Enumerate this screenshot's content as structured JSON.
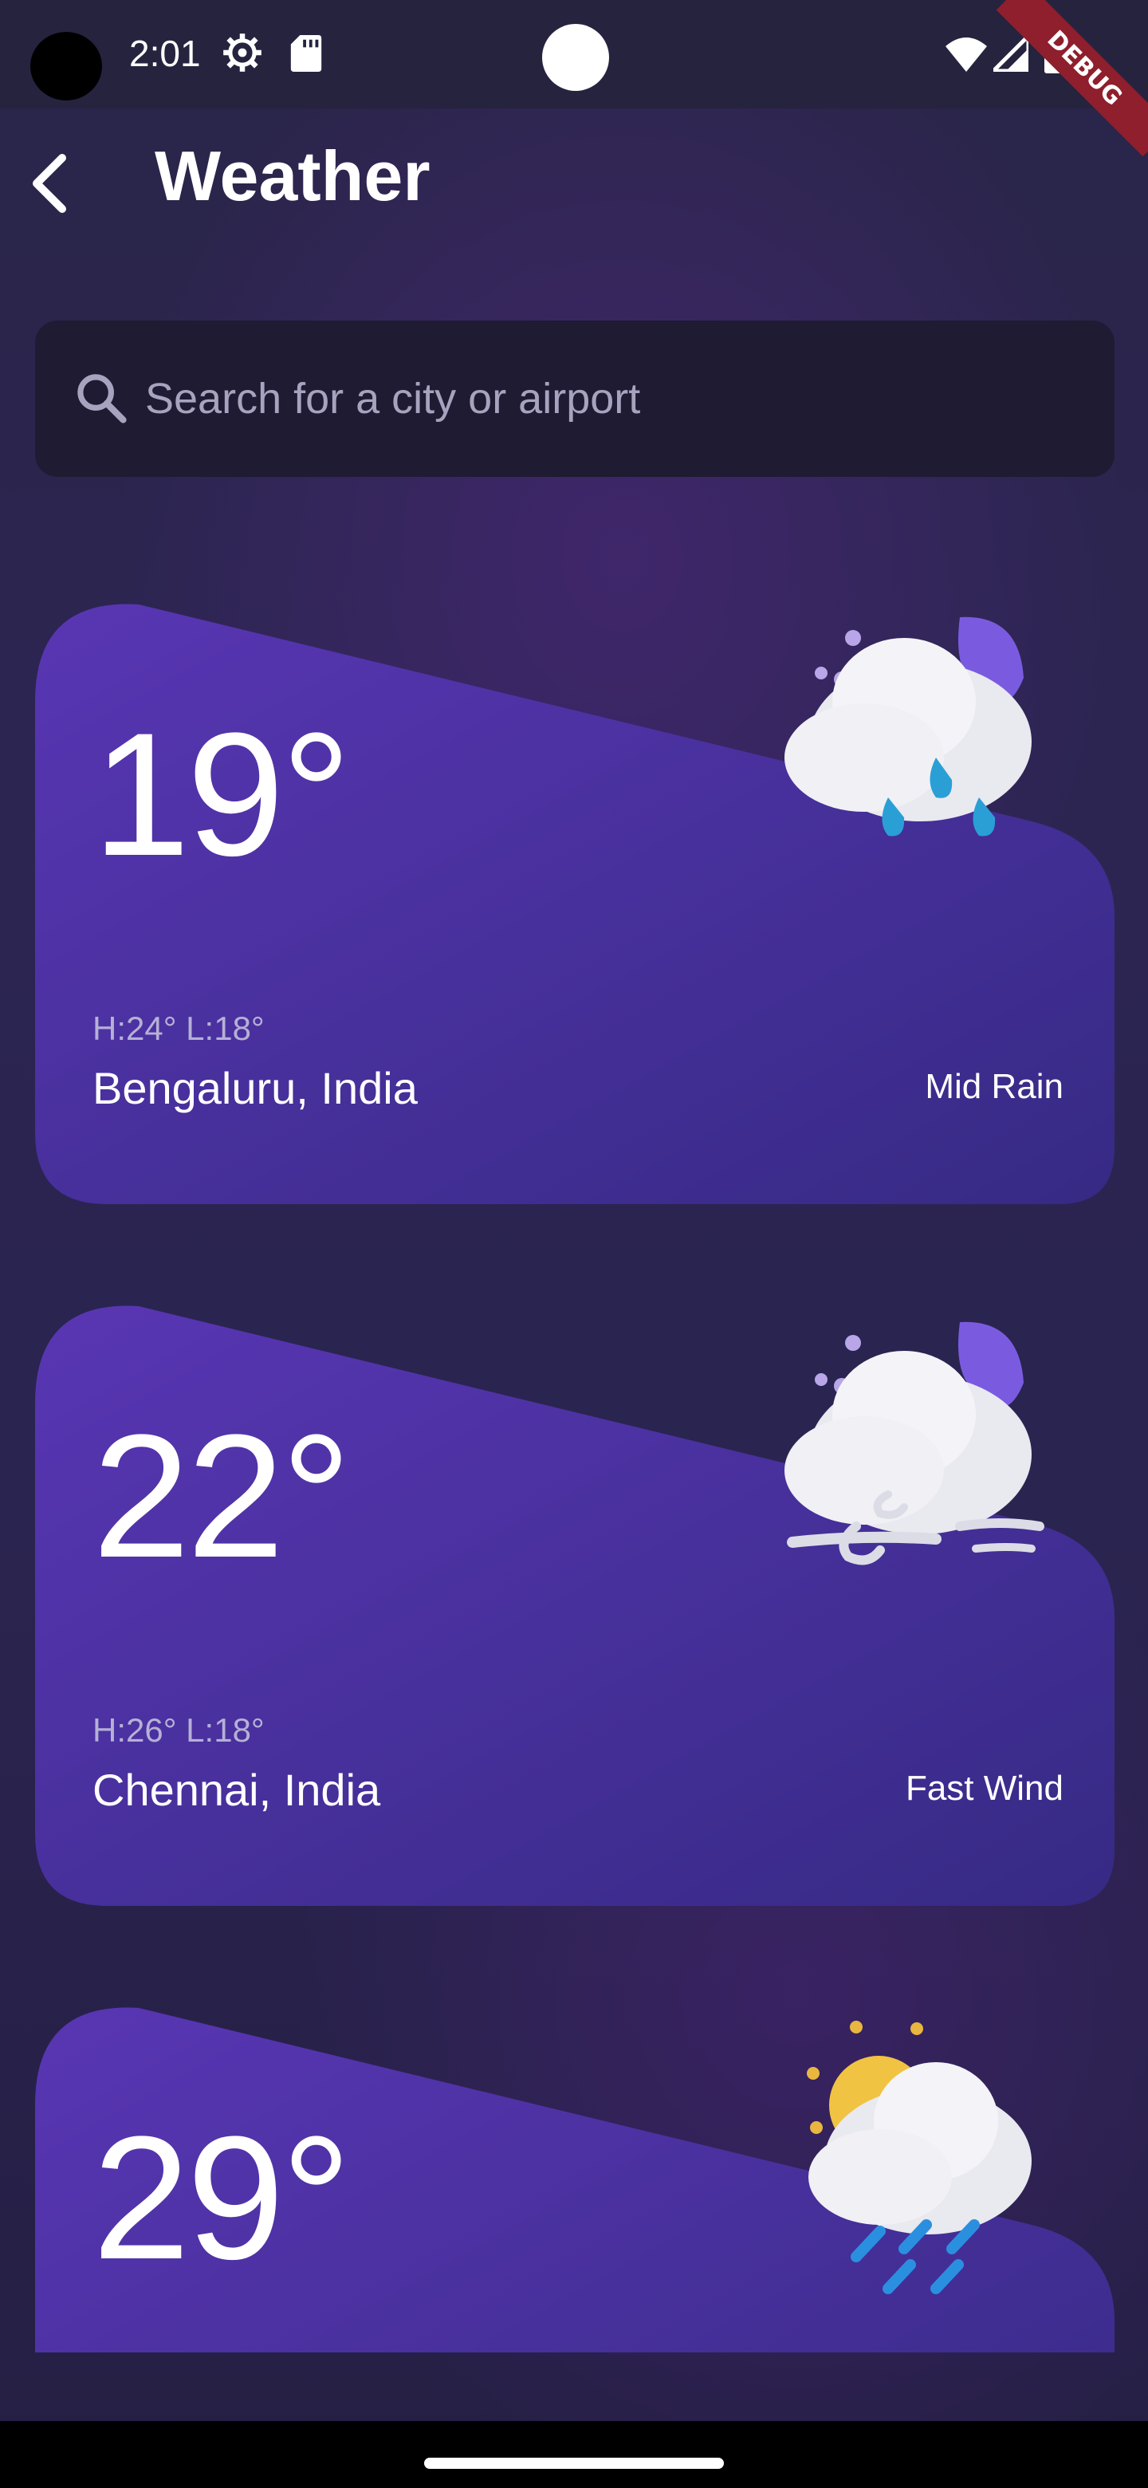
{
  "status_bar": {
    "time": "2:01",
    "debug_label": "DEBUG"
  },
  "app_bar": {
    "title": "Weather",
    "back_icon": "chevron-left-icon"
  },
  "search": {
    "placeholder": "Search for a city or airport",
    "value": "",
    "icon": "search-icon"
  },
  "cards": [
    {
      "temp": "19°",
      "high_low": "H:24° L:18°",
      "city": "Bengaluru, India",
      "condition": "Mid Rain",
      "icon": "moon-cloud-rain-icon"
    },
    {
      "temp": "22°",
      "high_low": "H:26° L:18°",
      "city": "Chennai, India",
      "condition": "Fast Wind",
      "icon": "moon-cloud-wind-icon"
    },
    {
      "temp": "29°",
      "high_low": "",
      "city": "",
      "condition": "",
      "icon": "sun-cloud-rain-icon"
    }
  ],
  "colors": {
    "background": "#2a2548",
    "card_gradient_start": "#5936b4",
    "card_gradient_end": "#362a84",
    "search_bg": "#1e1b33"
  }
}
